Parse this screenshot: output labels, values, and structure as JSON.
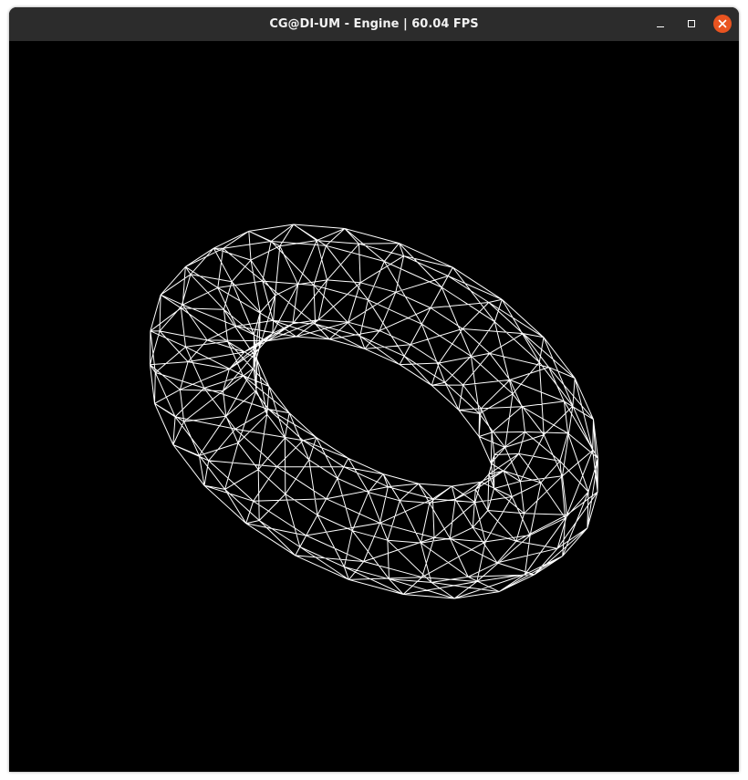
{
  "window": {
    "title": "CG@DI-UM - Engine | 60.04 FPS",
    "controls": {
      "minimize": "minimize-icon",
      "maximize": "maximize-icon",
      "close": "close-icon"
    },
    "close_color": "#e95420",
    "titlebar_color": "#2c2c2c"
  },
  "scene": {
    "background": "#000000",
    "wire_color": "#ffffff",
    "mode": "wireframe",
    "object": "torus",
    "rings": 24,
    "sides": 8
  }
}
